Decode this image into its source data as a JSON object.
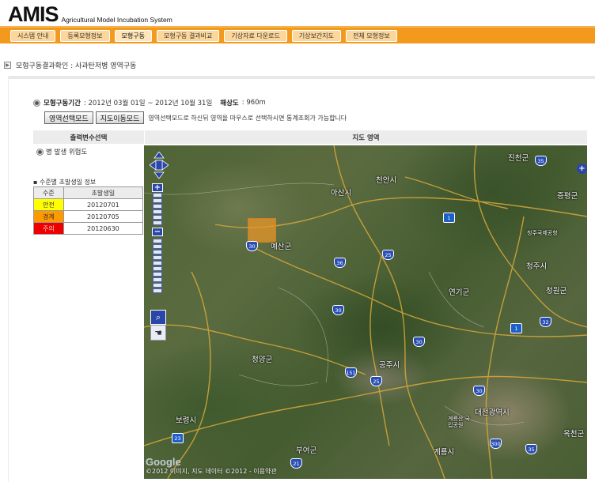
{
  "header": {
    "logo": "AMIS",
    "logo_sub": "Agricultural Model Incubation System"
  },
  "nav": [
    {
      "label": "시스템 안내",
      "name": "nav-system-intro"
    },
    {
      "label": "등록모형정보",
      "name": "nav-registered-models"
    },
    {
      "label": "모형구동",
      "name": "nav-model-run",
      "active": true
    },
    {
      "label": "모형구동 결과비교",
      "name": "nav-result-compare"
    },
    {
      "label": "기상자료 다운로드",
      "name": "nav-weather-download"
    },
    {
      "label": "기상보간지도",
      "name": "nav-weather-interp-map"
    },
    {
      "label": "전체 모형정보",
      "name": "nav-all-model-info"
    }
  ],
  "breadcrumb": "모형구동결과확인 : 사과탄저병 영역구동",
  "period": {
    "label": "모형구동기간",
    "value": ": 2012년 03월 01일 ~ 2012년 10월 31일",
    "res_label": "해상도",
    "res_value": ": 960m"
  },
  "mode": {
    "select_label": "영역선택모드",
    "move_label": "지도이동모드",
    "description": "영역선택모드로 하신뒤 영역을 마우스로 선택하시면 통계조회가 가능합니다"
  },
  "panel": {
    "var_header": "출력변수선택",
    "map_header": "지도 영역",
    "var_option": "병 발생 위험도"
  },
  "legend": {
    "title": "▪ 수준별 초발생일 정보",
    "col_level": "수준",
    "col_date": "초발생일",
    "rows": [
      {
        "level": "안전",
        "date": "20120701",
        "color": "#ffff00"
      },
      {
        "level": "경계",
        "date": "20120705",
        "color": "#ff9900"
      },
      {
        "level": "주의",
        "date": "20120630",
        "color": "#ee0000"
      }
    ]
  },
  "map": {
    "cities": [
      {
        "label": "천안시",
        "name": "city-cheonan"
      },
      {
        "label": "진천군",
        "name": "city-jincheon"
      },
      {
        "label": "증평군",
        "name": "city-jeungpyeong"
      },
      {
        "label": "아산시",
        "name": "city-asan"
      },
      {
        "label": "청주국제공항",
        "name": "city-cheongju-airport"
      },
      {
        "label": "예산군",
        "name": "city-yesan"
      },
      {
        "label": "청주시",
        "name": "city-cheongju"
      },
      {
        "label": "연기군",
        "name": "city-yeongi"
      },
      {
        "label": "청원군",
        "name": "city-cheongwon"
      },
      {
        "label": "청양군",
        "name": "city-cheongyang"
      },
      {
        "label": "공주시",
        "name": "city-gongju"
      },
      {
        "label": "보령시",
        "name": "city-boryeong"
      },
      {
        "label": "계룡시",
        "name": "city-gyeryong"
      },
      {
        "label": "대전광역시",
        "name": "city-daejeon"
      },
      {
        "label": "옥천군",
        "name": "city-okcheon"
      },
      {
        "label": "부여군",
        "name": "city-buyeo"
      },
      {
        "label": "계룡산 국립공원",
        "name": "city-gyeryongsan"
      }
    ],
    "highways": [
      "35",
      "1",
      "30",
      "25",
      "30",
      "1",
      "32",
      "30",
      "151",
      "25",
      "30",
      "36",
      "300",
      "35",
      "21",
      "23"
    ],
    "google": "Google",
    "copyright": "©2012 이미지, 지도 데이터 ©2012 - 이용약관"
  }
}
